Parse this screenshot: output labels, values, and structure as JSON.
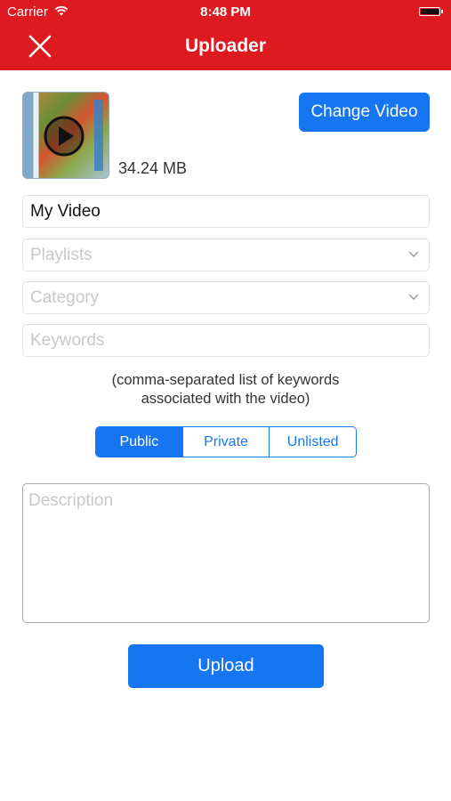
{
  "status_bar": {
    "carrier": "Carrier",
    "time": "8:48 PM"
  },
  "header": {
    "title": "Uploader",
    "close_icon": "close-icon",
    "background_color": "#dc1a1f"
  },
  "video": {
    "file_size": "34.24 MB",
    "change_label": "Change Video",
    "thumbnail_icon": "play-icon"
  },
  "form": {
    "title_value": "My Video",
    "playlists_placeholder": "Playlists",
    "category_placeholder": "Category",
    "keywords_placeholder": "Keywords",
    "keywords_hint_line1": "(comma-separated list of keywords",
    "keywords_hint_line2": "associated with the video)",
    "privacy_options": [
      "Public",
      "Private",
      "Unlisted"
    ],
    "privacy_selected": "Public",
    "description_placeholder": "Description",
    "upload_label": "Upload"
  },
  "colors": {
    "accent": "#1676f2"
  }
}
